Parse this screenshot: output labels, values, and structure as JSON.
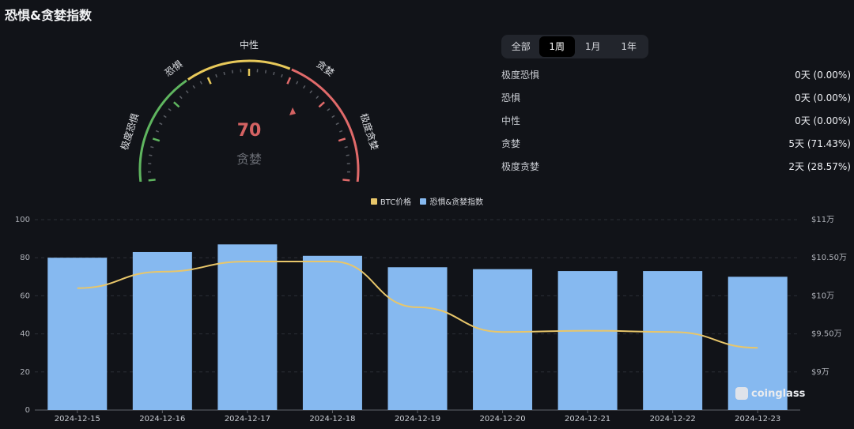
{
  "page": {
    "title": "恐惧&贪婪指数"
  },
  "gauge": {
    "value": "70",
    "sentiment": "贪婪",
    "labels": {
      "extreme_fear": "极度恐惧",
      "fear": "恐惧",
      "neutral": "中性",
      "greed": "贪婪",
      "extreme_greed": "极度贪婪"
    },
    "colors": {
      "green": "#5fb55f",
      "yellow": "#e8c95a",
      "red": "#e06a6a",
      "value": "#d46262"
    }
  },
  "tabs": [
    {
      "label": "全部",
      "active": false
    },
    {
      "label": "1周",
      "active": true
    },
    {
      "label": "1月",
      "active": false
    },
    {
      "label": "1年",
      "active": false
    }
  ],
  "stats": [
    {
      "label": "极度恐惧",
      "value": "0天 (0.00%)"
    },
    {
      "label": "恐惧",
      "value": "0天 (0.00%)"
    },
    {
      "label": "中性",
      "value": "0天 (0.00%)"
    },
    {
      "label": "贪婪",
      "value": "5天 (71.43%)"
    },
    {
      "label": "极度贪婪",
      "value": "2天 (28.57%)"
    }
  ],
  "legend": {
    "btc": "BTC价格",
    "index": "恐惧&贪婪指数"
  },
  "watermark": "coinglass",
  "chart_data": {
    "type": "bar",
    "categories": [
      "2024-12-15",
      "2024-12-16",
      "2024-12-17",
      "2024-12-18",
      "2024-12-19",
      "2024-12-20",
      "2024-12-21",
      "2024-12-22",
      "2024-12-23"
    ],
    "series": [
      {
        "name": "恐惧&贪婪指数",
        "type": "bar",
        "axis": "left",
        "color": "#86b9f0",
        "values": [
          80,
          83,
          87,
          81,
          75,
          74,
          73,
          73,
          70
        ]
      },
      {
        "name": "BTC价格",
        "type": "line",
        "axis": "right",
        "color": "#e8c66a",
        "values": [
          104200,
          106800,
          108400,
          108400,
          101200,
          97300,
          97500,
          97300,
          94800
        ]
      }
    ],
    "left_axis": {
      "ylim": [
        0,
        100
      ],
      "ticks": [
        "0",
        "20",
        "40",
        "60",
        "80",
        "100"
      ]
    },
    "right_axis": {
      "ylim": [
        85000,
        115000
      ],
      "ticks": [
        "$9万",
        "$9.50万",
        "$10万",
        "$10.50万",
        "$11万",
        "$11万"
      ]
    },
    "grid": true,
    "legend_position": "top-center"
  }
}
